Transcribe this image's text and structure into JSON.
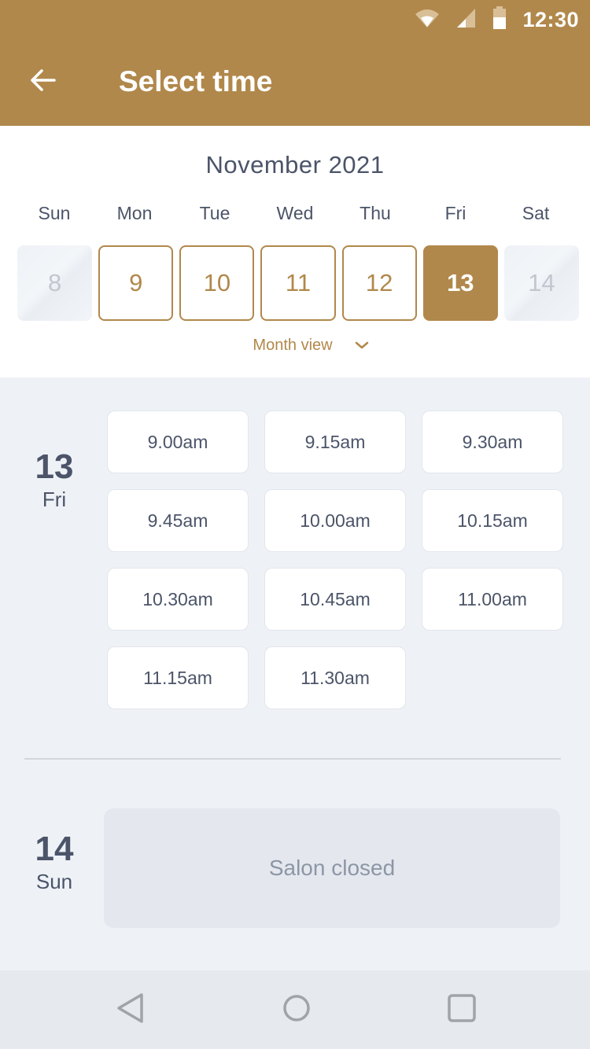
{
  "status_bar": {
    "time": "12:30",
    "icons": [
      "wifi-icon",
      "cell-signal-icon",
      "battery-icon"
    ]
  },
  "app_bar": {
    "title": "Select time",
    "back_icon": "arrow-left-icon"
  },
  "calendar": {
    "month_title": "November 2021",
    "weekdays": [
      "Sun",
      "Mon",
      "Tue",
      "Wed",
      "Thu",
      "Fri",
      "Sat"
    ],
    "days": [
      {
        "label": "8",
        "state": "disabled"
      },
      {
        "label": "9",
        "state": "available"
      },
      {
        "label": "10",
        "state": "available"
      },
      {
        "label": "11",
        "state": "available"
      },
      {
        "label": "12",
        "state": "available"
      },
      {
        "label": "13",
        "state": "selected"
      },
      {
        "label": "14",
        "state": "disabled"
      }
    ],
    "month_view_label": "Month view",
    "month_view_icon": "chevron-down-icon"
  },
  "schedule": [
    {
      "day_number": "13",
      "day_name": "Fri",
      "slots": [
        "9.00am",
        "9.15am",
        "9.30am",
        "9.45am",
        "10.00am",
        "10.15am",
        "10.30am",
        "10.45am",
        "11.00am",
        "11.15am",
        "11.30am"
      ]
    },
    {
      "day_number": "14",
      "day_name": "Sun",
      "closed_message": "Salon closed"
    }
  ],
  "nav_bar": {
    "icons": [
      "nav-back-icon",
      "nav-home-icon",
      "nav-recents-icon"
    ]
  },
  "colors": {
    "accent": "#b1884b",
    "background": "#eef2f7",
    "text": "#4b5468",
    "disabled_text": "#c2c7cf",
    "closed_box": "#e4e8ee"
  }
}
